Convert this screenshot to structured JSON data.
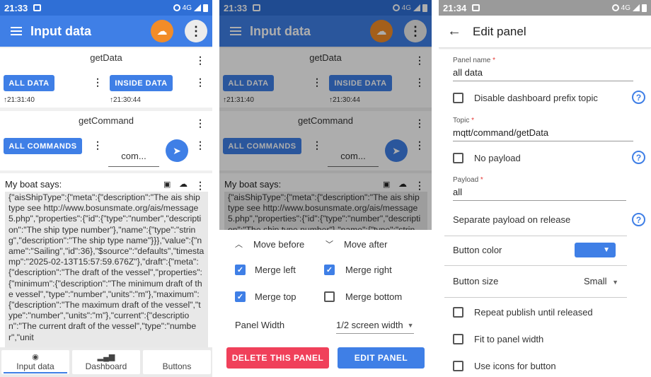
{
  "status": {
    "time1": "21:33",
    "time2": "21:33",
    "time3": "21:34",
    "network": "4G"
  },
  "app": {
    "title": "Input data"
  },
  "cards": {
    "getData": {
      "title": "getData",
      "btn1": "ALL DATA",
      "ts1": "21:31:40",
      "btn2": "INSIDE DATA",
      "ts2": "21:30:44"
    },
    "getCommand": {
      "title": "getCommand",
      "btn1": "ALL COMMANDS",
      "input_value": "com..."
    }
  },
  "text_panel": {
    "title": "My boat says:",
    "body": "{\"aisShipType\":{\"meta\":{\"description\":\"The ais ship type see http://www.bosunsmate.org/ais/message5.php\",\"properties\":{\"id\":{\"type\":\"number\",\"description\":\"The ship type number\"},\"name\":{\"type\":\"string\",\"description\":\"The ship type name\"}}},\"value\":{\"name\":\"Sailing\",\"id\":36},\"$source\":\"defaults\",\"timestamp\":\"2025-02-13T15:57:59.676Z\"},\"draft\":{\"meta\":{\"description\":\"The draft of the vessel\",\"properties\":{\"minimum\":{\"description\":\"The minimum draft of the vessel\",\"type\":\"number\",\"units\":\"m\"},\"maximum\":{\"description\":\"The maximum draft of the vessel\",\"type\":\"number\",\"units\":\"m\"},\"current\":{\"description\":\"The current draft of the vessel\",\"type\":\"number\",\"unit"
  },
  "bottom_nav": [
    "Input data",
    "Dashboard",
    "Buttons"
  ],
  "sheet": {
    "move_before": "Move before",
    "move_after": "Move after",
    "merge_left": "Merge left",
    "merge_right": "Merge right",
    "merge_top": "Merge top",
    "merge_bottom": "Merge bottom",
    "panel_width_label": "Panel Width",
    "panel_width_value": "1/2 screen width",
    "delete_btn": "DELETE THIS PANEL",
    "edit_btn": "EDIT PANEL",
    "checks": {
      "merge_left": true,
      "merge_right": true,
      "merge_top": true,
      "merge_bottom": false
    }
  },
  "edit_panel": {
    "title": "Edit panel",
    "panel_name_label": "Panel name",
    "panel_name_value": "all data",
    "disable_prefix": "Disable dashboard prefix topic",
    "topic_label": "Topic",
    "topic_value": "mqtt/command/getData",
    "no_payload": "No payload",
    "payload_label": "Payload",
    "payload_value": "all",
    "separate_payload": "Separate payload on release",
    "button_color": "Button color",
    "button_size": "Button size",
    "button_size_value": "Small",
    "repeat_publish": "Repeat publish until released",
    "fit_width": "Fit to panel width",
    "use_icons": "Use icons for button",
    "required_mark": "*"
  },
  "colors": {
    "primary": "#3f7fe6",
    "accent": "#f28c28",
    "danger": "#f0405a"
  }
}
